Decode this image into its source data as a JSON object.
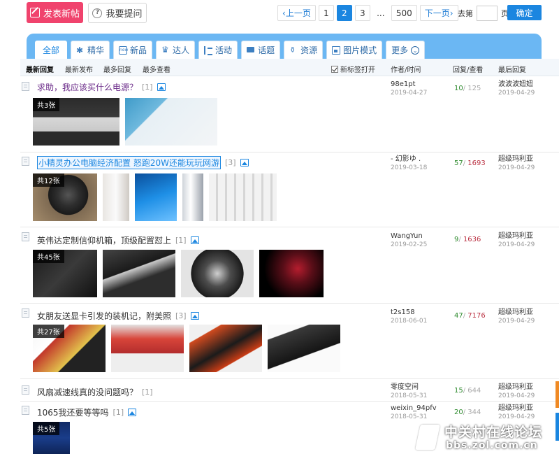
{
  "toolbar": {
    "post_label": "发表新帖",
    "ask_label": "我要提问"
  },
  "pagination": {
    "prev": "上一页",
    "pages": [
      "1",
      "2",
      "3"
    ],
    "current": "2",
    "ellipsis": "...",
    "last": "500",
    "next": "下一页",
    "goto_prefix": "去第",
    "goto_suffix": "页",
    "goto_value": "",
    "confirm": "确定"
  },
  "tabs": [
    {
      "label": "全部",
      "icon": "none",
      "active": true
    },
    {
      "label": "精华",
      "icon": "star-icon"
    },
    {
      "label": "新品",
      "icon": "new-icon"
    },
    {
      "label": "达人",
      "icon": "crown-icon"
    },
    {
      "label": "活动",
      "icon": "list-icon"
    },
    {
      "label": "话题",
      "icon": "chat-icon"
    },
    {
      "label": "资源",
      "icon": "resource-icon"
    },
    {
      "label": "图片模式",
      "icon": "picture-icon"
    },
    {
      "label": "更多",
      "icon": "chevron-down-icon"
    }
  ],
  "sort": {
    "latest_reply": "最新回复",
    "latest_post": "最新发布",
    "most_reply": "最多回复",
    "most_view": "最多查看",
    "new_tab": "新标签打开",
    "col_author": "作者/时间",
    "col_stats": "回复/查看",
    "col_last": "最后回复"
  },
  "threads": [
    {
      "title": "求助，我应该买什么电源？",
      "count": "[1]",
      "author": "98e1pt",
      "date": "2019-04-27",
      "replies": "10",
      "views": "125",
      "last_user": "波波波妞妞",
      "last_date": "2019-04-29",
      "badge": "共3张"
    },
    {
      "title": "小精灵办公电脑经济配置 怒跑20W还能玩玩网游",
      "count": "[3]",
      "author": "- 幻影ゆ .",
      "date": "2019-03-18",
      "replies": "57",
      "views": "1693",
      "last_user": "超级玛利亚",
      "last_date": "2019-04-29",
      "badge": "共12张"
    },
    {
      "title": "英伟达定制信仰机箱，顶级配置怼上",
      "count": "[1]",
      "author": "WangYun",
      "date": "2019-02-25",
      "replies": "9",
      "views": "1636",
      "last_user": "超级玛利亚",
      "last_date": "2019-04-29",
      "badge": "共45张"
    },
    {
      "title": "女朋友送显卡引发的装机记，附美照",
      "count": "[3]",
      "author": "t2s158",
      "date": "2018-06-01",
      "replies": "47",
      "views": "7176",
      "last_user": "超级玛利亚",
      "last_date": "2019-04-29",
      "badge": "共27张"
    },
    {
      "title": "风扇减速线真的没问题吗？",
      "count": "[1]",
      "author": "零度空间",
      "date": "2018-05-31",
      "replies": "15",
      "views": "644",
      "last_user": "超级玛利亚",
      "last_date": "2019-04-29"
    },
    {
      "title": "1065我还要等等吗",
      "count": "[1]",
      "author": "weixin_94pfv",
      "date": "2018-05-31",
      "replies": "20",
      "views": "344",
      "last_user": "超级玛利亚",
      "last_date": "2019-04-29",
      "badge": "共5张"
    }
  ],
  "watermark": {
    "name": "中关村在线论坛",
    "url": "bbs.zol.com.cn"
  },
  "colors": {
    "post_button": "#f0436d",
    "primary": "#1b86e0",
    "tab_band": "#6bb7f3",
    "reply_count": "#2e8b2e"
  }
}
